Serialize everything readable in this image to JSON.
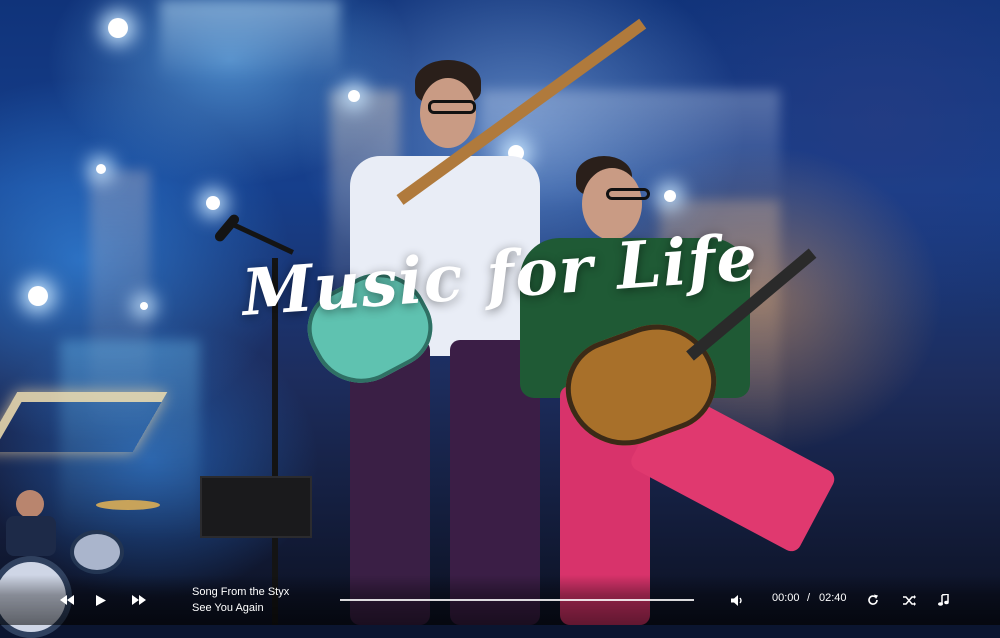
{
  "hero": {
    "title": "Music for Life"
  },
  "player": {
    "current_track": "Song From the Styx",
    "next_track": "See You Again",
    "elapsed": "00:00",
    "separator": "/",
    "duration": "02:40",
    "progress": 0,
    "icons": {
      "prev": "rewind-icon",
      "play": "play-icon",
      "next": "fast-forward-icon",
      "volume": "volume-icon",
      "repeat": "repeat-icon",
      "shuffle": "shuffle-icon",
      "playlist": "music-note-icon"
    }
  }
}
